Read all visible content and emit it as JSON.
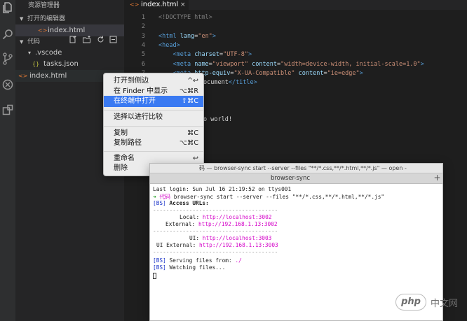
{
  "activity_bar": {
    "icons": [
      "files-icon",
      "search-icon",
      "source-control-icon",
      "debug-icon",
      "extensions-icon"
    ]
  },
  "sidebar": {
    "title": "资源管理器",
    "open_editors_header": "打开的编辑器",
    "open_editors": [
      {
        "label": "index.html",
        "icon": "<>"
      }
    ],
    "folder_header": "代码",
    "tree": [
      {
        "label": ".vscode",
        "chevron": "▾"
      },
      {
        "label": "tasks.json",
        "icon": "{}"
      },
      {
        "label": "index.html",
        "icon": "<>"
      }
    ]
  },
  "editor": {
    "tab_label": "index.html",
    "line_numbers": [
      "1",
      "2",
      "3",
      "4",
      "5",
      "6",
      "7",
      "8",
      "9",
      "10",
      "11",
      "12"
    ],
    "lines": [
      {
        "a": "<!DOCTYPE html>"
      },
      {},
      {
        "t1": "<html ",
        "a1": "lang",
        "p1": "=",
        "s1": "\"en\"",
        "t2": ">"
      },
      {
        "t1": "<head>"
      },
      {
        "i": "    ",
        "t1": "<meta ",
        "a1": "charset",
        "p1": "=",
        "s1": "\"UTF-8\"",
        "t2": ">"
      },
      {
        "i": "    ",
        "t1": "<meta ",
        "a1": "name",
        "p1": "=",
        "s1": "\"viewport\"",
        "p2": " ",
        "a2": "content",
        "p3": "=",
        "s2": "\"width=device-width, initial-scale=1.0\"",
        "t2": ">"
      },
      {
        "i": "    ",
        "t1": "<meta ",
        "a1": "http-equiv",
        "p1": "=",
        "s1": "\"X-UA-Compatible\"",
        "p2": " ",
        "a2": "content",
        "p3": "=",
        "s2": "\"ie=edge\"",
        "t2": ">"
      },
      {
        "p": "ocument",
        "t2": "</title>"
      },
      {},
      {},
      {},
      {
        "p": "o world!"
      }
    ]
  },
  "context_menu": {
    "items": [
      {
        "label": "打开到侧边",
        "shortcut": "^↩"
      },
      {
        "label": "在 Finder 中显示",
        "shortcut": "⌥⌘R"
      },
      {
        "label": "在终端中打开",
        "shortcut": "⇧⌘C",
        "highlighted": true
      },
      {
        "label": "选择以进行比较",
        "shortcut": ""
      },
      {
        "label": "复制",
        "shortcut": "⌘C"
      },
      {
        "label": "复制路径",
        "shortcut": "⌥⌘C"
      },
      {
        "label": "重命名",
        "shortcut": "↩"
      },
      {
        "label": "删除",
        "shortcut": "⌘⌫"
      }
    ]
  },
  "terminal": {
    "window_title": "码 — browser-sync start --server --files \"**/*.css,**/*.html,**/*.js\" — open -",
    "tab_label": "browser-sync",
    "plus": "+",
    "line_last_login": "Last login: Sun Jul 16 21:19:52 on ttys001",
    "prompt_arrow": "➜",
    "prompt_dir": "代码",
    "command": "browser-sync start --server --files \"**/*.css,**/*.html,**/*.js\"",
    "bs_tag": "[BS]",
    "access_urls": "Access URLs:",
    "dashes": "--------------------------------------",
    "local_label": "Local:",
    "local_url": "http://localhost:3002",
    "external_label": "External:",
    "external_url": "http://192.168.1.13:3002",
    "ui_label": "UI:",
    "ui_url": "http://localhost:3003",
    "ui_external_label": "UI External:",
    "ui_external_url": "http://192.168.1.13:3003",
    "serving": "Serving files from:",
    "serving_path": "./",
    "watching": "Watching files..."
  },
  "watermark": {
    "logo_text": "php",
    "site_text": "中文网"
  },
  "colors": {
    "highlight": "#3a7af2",
    "pink": "#d400c8",
    "tag": "#569cd6",
    "string": "#ce9178"
  }
}
